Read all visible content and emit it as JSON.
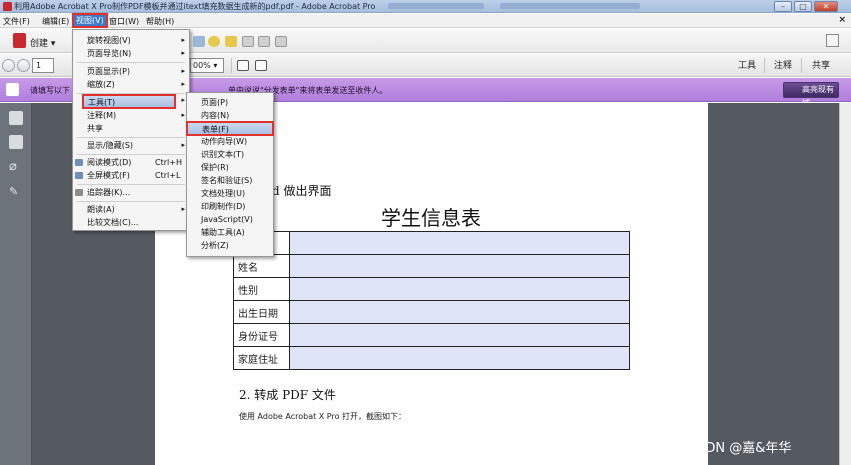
{
  "window": {
    "title": "利用Adobe Acrobat X Pro制作PDF模板并通过itext填充数据生成新的pdf.pdf - Adobe Acrobat Pro"
  },
  "menubar": {
    "items": [
      "文件(F)",
      "编辑(E)",
      "视图(V)",
      "窗口(W)",
      "帮助(H)"
    ],
    "active_index": 2,
    "close_glyph": "×"
  },
  "toolbar1": {
    "create_label": "创建 ▾"
  },
  "toolbar2": {
    "page_number": "1",
    "zoom": "00%",
    "tabs": [
      "工具",
      "注释",
      "共享"
    ]
  },
  "banner": {
    "text_left": "请填写以下",
    "text_right": "单中说说\"分发表单\"来将表单发送至收件人。",
    "button_label": "高亮现有域"
  },
  "view_menu": {
    "items": [
      {
        "label": "旋转视图(V)",
        "shortcut": "",
        "arrow": true
      },
      {
        "label": "页面导览(N)",
        "shortcut": "",
        "arrow": true
      },
      {
        "label": "页面显示(P)",
        "shortcut": "",
        "arrow": true
      },
      {
        "label": "缩放(Z)",
        "shortcut": "",
        "arrow": true
      },
      {
        "label": "工具(T)",
        "shortcut": "",
        "arrow": true
      },
      {
        "label": "注释(M)",
        "shortcut": "",
        "arrow": true
      },
      {
        "label": "共享",
        "shortcut": "",
        "arrow": false
      },
      {
        "label": "显示/隐藏(S)",
        "shortcut": "",
        "arrow": true
      },
      {
        "label": "阅读模式(D)",
        "shortcut": "Ctrl+H",
        "arrow": false
      },
      {
        "label": "全屏模式(F)",
        "shortcut": "Ctrl+L",
        "arrow": false
      },
      {
        "label": "追踪器(K)...",
        "shortcut": "",
        "arrow": false
      },
      {
        "label": "朗读(A)",
        "shortcut": "",
        "arrow": true
      },
      {
        "label": "比较文档(C)...",
        "shortcut": "",
        "arrow": false
      }
    ]
  },
  "tools_submenu": {
    "items": [
      "页面(P)",
      "内容(N)",
      "表单(F)",
      "动作向导(W)",
      "识别文本(T)",
      "保护(R)",
      "签名和验证(S)",
      "文档处理(U)",
      "印刷制作(D)",
      "JavaScript(V)",
      "辅助工具(A)",
      "分析(Z)"
    ],
    "highlighted_index": 2
  },
  "document": {
    "heading1": "ord 做出界面",
    "table_title": "学生信息表",
    "rows": [
      "",
      "姓名",
      "性别",
      "出生日期",
      "身份证号",
      "家庭住址"
    ],
    "heading2": "2. 转成 PDF 文件",
    "body_text": "使用 Adobe Acrobat X Pro 打开，截图如下："
  },
  "watermark": "CSDN @嘉&年华",
  "colors": {
    "banner": "#b98ae2",
    "field_fill": "#dfe4f9",
    "highlight_outline": "#e0312c",
    "menu_highlight": "#a9c1e4"
  }
}
